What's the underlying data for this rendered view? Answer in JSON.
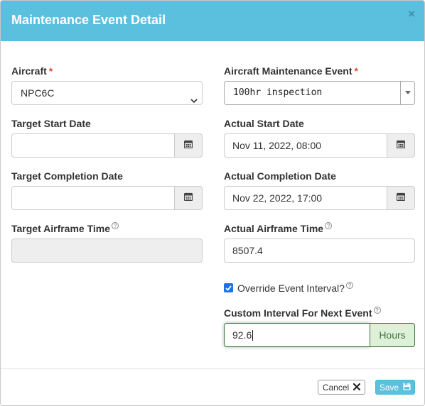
{
  "header": {
    "title": "Maintenance Event Detail",
    "close_label": "×"
  },
  "required_marker": "*",
  "help_glyph": "?",
  "left": {
    "aircraft": {
      "label": "Aircraft",
      "value": "NPC6C"
    },
    "target_start_date": {
      "label": "Target Start Date",
      "value": ""
    },
    "target_completion_date": {
      "label": "Target Completion Date",
      "value": ""
    },
    "target_airframe_time": {
      "label": "Target Airframe Time",
      "value": ""
    }
  },
  "right": {
    "maintenance_event": {
      "label": "Aircraft Maintenance Event",
      "value": "100hr inspection"
    },
    "actual_start_date": {
      "label": "Actual Start Date",
      "value": "Nov 11, 2022, 08:00"
    },
    "actual_completion_date": {
      "label": "Actual Completion Date",
      "value": "Nov 22, 2022, 17:00"
    },
    "actual_airframe_time": {
      "label": "Actual Airframe Time",
      "value": "8507.4"
    },
    "override_interval": {
      "label": "Override Event Interval?",
      "checked": true
    },
    "custom_interval": {
      "label": "Custom Interval For Next Event",
      "value": "92.6",
      "unit": "Hours"
    }
  },
  "footer": {
    "cancel_label": "Cancel",
    "save_label": "Save"
  },
  "colors": {
    "header_bg": "#5bc0de",
    "required": "#e04b2f",
    "success_text": "#3c763d",
    "success_bg": "#dff0d8",
    "checkbox": "#1a73e8"
  }
}
